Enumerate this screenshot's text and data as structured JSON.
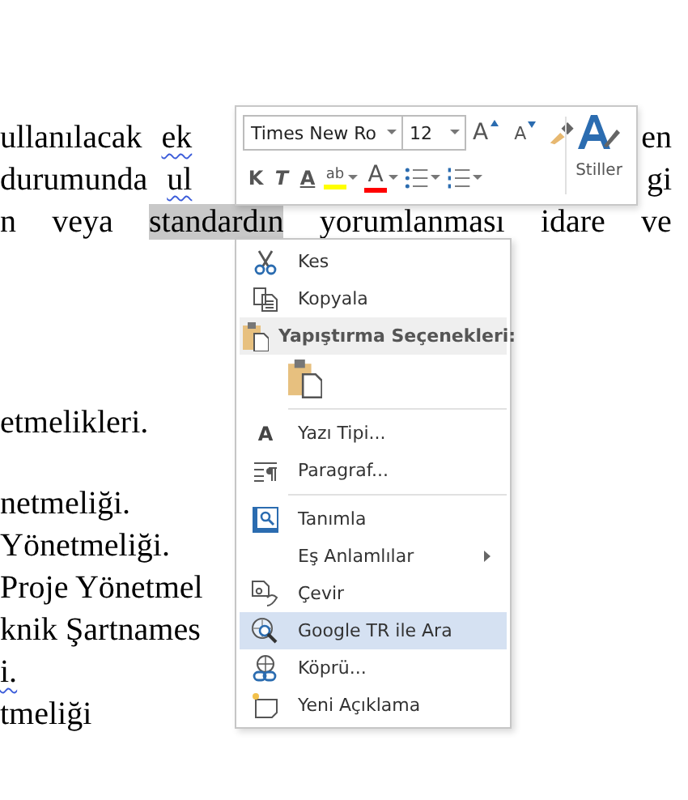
{
  "document": {
    "paragraphs": [
      {
        "lines": [
          {
            "left": [
              {
                "text": "ullanılacak",
                "spell_error": false,
                "highlighted": false
              },
              {
                "text": "ek",
                "spell_error": true,
                "highlighted": false
              }
            ],
            "right": [
              {
                "text": "en",
                "spell_error": false,
                "highlighted": false
              }
            ]
          },
          {
            "left": [
              {
                "text": "durumunda",
                "spell_error": false,
                "highlighted": false
              },
              {
                "text": "ul",
                "spell_error": true,
                "highlighted": false
              }
            ],
            "right": [
              {
                "text": "gi",
                "spell_error": false,
                "highlighted": false
              }
            ]
          },
          {
            "justified": [
              {
                "text": "n",
                "spell_error": false,
                "highlighted": false
              },
              {
                "text": "veya",
                "spell_error": false,
                "highlighted": false
              },
              {
                "text": "standardın",
                "spell_error": false,
                "highlighted": true
              },
              {
                "text": "yorumlanması",
                "spell_error": false,
                "highlighted": false
              },
              {
                "text": "idare",
                "spell_error": false,
                "highlighted": false
              },
              {
                "text": "ve",
                "spell_error": false,
                "highlighted": false
              }
            ]
          }
        ]
      },
      {
        "lines": [
          {
            "left": [
              {
                "text": "etmelikleri.",
                "spell_error": false,
                "highlighted": false
              }
            ]
          }
        ]
      },
      {
        "lines": [
          {
            "left": [
              {
                "text": "netmeliği.",
                "spell_error": false,
                "highlighted": false
              }
            ]
          },
          {
            "left": [
              {
                "text": "Yönetmeliği.",
                "spell_error": false,
                "highlighted": false
              }
            ]
          },
          {
            "left": [
              {
                "text": "Proje Yönetmel",
                "spell_error": false,
                "highlighted": false
              }
            ]
          },
          {
            "left": [
              {
                "text": "knik Şartnames",
                "spell_error": false,
                "highlighted": false
              }
            ]
          },
          {
            "left": [
              {
                "text": "i.",
                "spell_error": true,
                "highlighted": false
              }
            ]
          },
          {
            "left": [
              {
                "text": "tmeliği",
                "spell_error": false,
                "highlighted": false
              }
            ]
          }
        ]
      }
    ]
  },
  "toolbar": {
    "font_name": "Times New Ro",
    "font_size": "12",
    "styles_label": "Stiller",
    "row1": [
      {
        "kind": "grow_font",
        "label": "A"
      },
      {
        "kind": "shrink_font",
        "label": "A"
      },
      {
        "kind": "format_painter"
      }
    ],
    "row2": [
      {
        "kind": "bold",
        "label": "K"
      },
      {
        "kind": "italic",
        "label": "T"
      },
      {
        "kind": "underline",
        "label": "A"
      },
      {
        "kind": "highlight",
        "label": "ab",
        "color": "#ffff00"
      },
      {
        "kind": "font_color",
        "label": "A",
        "color": "#ff0000"
      },
      {
        "kind": "bullets"
      },
      {
        "kind": "numbering"
      }
    ]
  },
  "context_menu": {
    "items": [
      {
        "kind": "cut",
        "label": "Kes",
        "selected": false
      },
      {
        "kind": "copy",
        "label": "Kopyala",
        "selected": false
      },
      {
        "kind": "paste_header",
        "label": "Yapıştırma Seçenekleri:",
        "selected": false
      },
      {
        "kind": "paste_option",
        "selected": false
      },
      {
        "kind": "separator"
      },
      {
        "kind": "font",
        "icon_text": "A",
        "label": "Yazı Tipi...",
        "selected": false
      },
      {
        "kind": "paragraph",
        "label": "Paragraf...",
        "selected": false
      },
      {
        "kind": "separator"
      },
      {
        "kind": "define",
        "label": "Tanımla",
        "selected": false
      },
      {
        "kind": "synonyms",
        "label": "Eş Anlamlılar",
        "selected": false
      },
      {
        "kind": "translate",
        "label": "Çevir",
        "selected": false
      },
      {
        "kind": "search",
        "label": "Google TR ile Ara",
        "selected": true
      },
      {
        "kind": "link",
        "label": "Köprü...",
        "selected": false
      },
      {
        "kind": "comment",
        "label": "Yeni Açıklama",
        "selected": false
      }
    ]
  }
}
